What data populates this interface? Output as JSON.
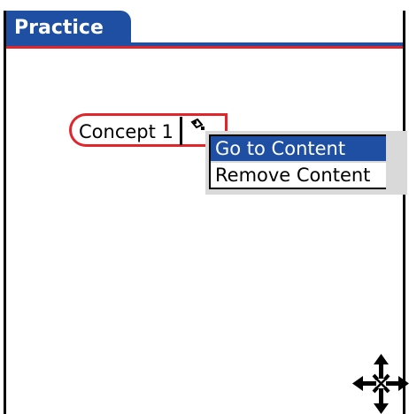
{
  "title": {
    "text": "Practice"
  },
  "concept": {
    "label": "Concept 1"
  },
  "menu": {
    "items": [
      {
        "label": "Go to Content",
        "selected": true
      },
      {
        "label": "Remove Content",
        "selected": false
      }
    ]
  },
  "icons": {
    "content": "content-link-icon",
    "move": "move-cursor-icon"
  },
  "colors": {
    "title_bar": "#1f4fa3",
    "accent_red": "#e3242b",
    "menu_bg": "#d9d9d9",
    "selection": "#1f4fa3"
  }
}
